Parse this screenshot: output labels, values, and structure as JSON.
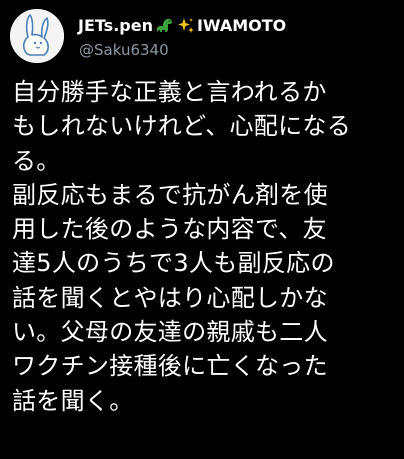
{
  "user": {
    "name_part1": "JETs.pen",
    "name_part2": "IWAMOTO",
    "handle": "@Saku6340",
    "avatar_icon": "rabbit-avatar-icon",
    "emoji_icons": [
      "dinosaur-emoji-icon",
      "sparkles-emoji-icon"
    ]
  },
  "tweet": {
    "lines": [
      "自分勝手な正義と言われるか",
      "もしれないけれど、心配になる",
      "る。",
      "副反応もまるで抗がん剤を使",
      "用した後のような内容で、友",
      "達5人のうちで3人も副反応の",
      "話を聞くとやはり心配しかな",
      "い。父母の友達の親戚も二人",
      "ワクチン接種後に亡くなった",
      "話を聞く。"
    ]
  },
  "colors": {
    "background": "#000000",
    "text": "#ffffff",
    "secondary_text": "#8b98a5",
    "dinosaur": "#3aa33c",
    "sparkles": "#f5c518"
  }
}
